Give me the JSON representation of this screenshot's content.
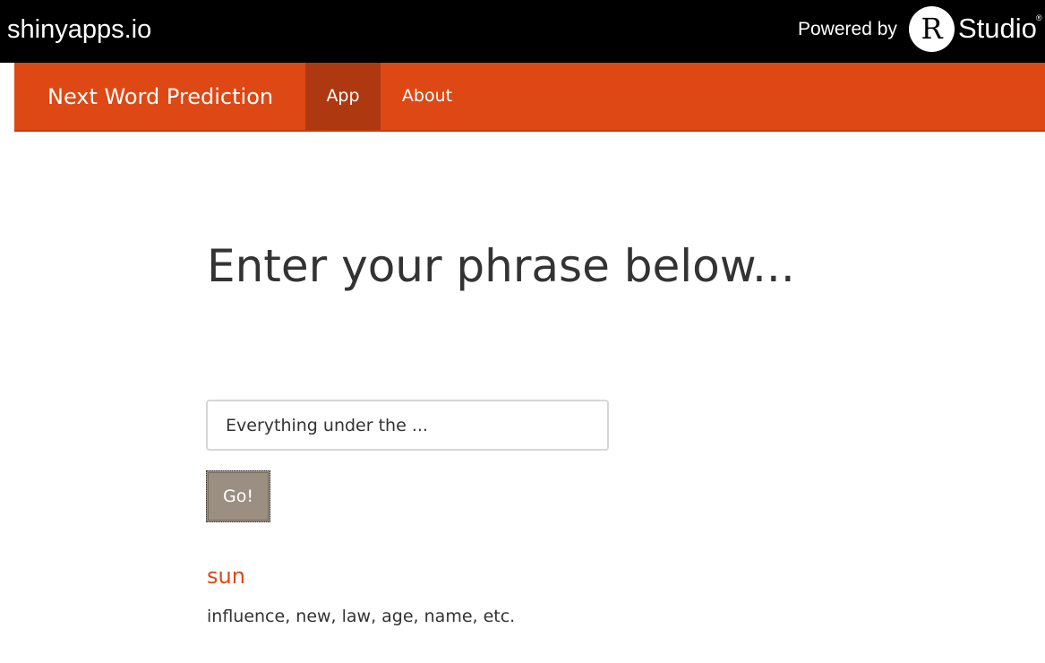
{
  "topbar": {
    "site_name": "shinyapps.io",
    "powered_by": "Powered by",
    "logo_letter": "R",
    "logo_text": "Studio",
    "registered_mark": "®"
  },
  "navbar": {
    "brand": "Next Word Prediction",
    "tabs": [
      {
        "label": "App",
        "active": true
      },
      {
        "label": "About",
        "active": false
      }
    ]
  },
  "main": {
    "heading": "Enter your phrase below...",
    "input_value": "Everything under the ...",
    "button_label": "Go!",
    "prediction": "sun",
    "alternatives": "influence, new, law, age, name, etc."
  },
  "colors": {
    "topbar_bg": "#000000",
    "navbar_bg": "#dd4814",
    "active_tab_bg": "#ae3910",
    "button_bg": "#9b8f82",
    "prediction_color": "#dd4814"
  }
}
